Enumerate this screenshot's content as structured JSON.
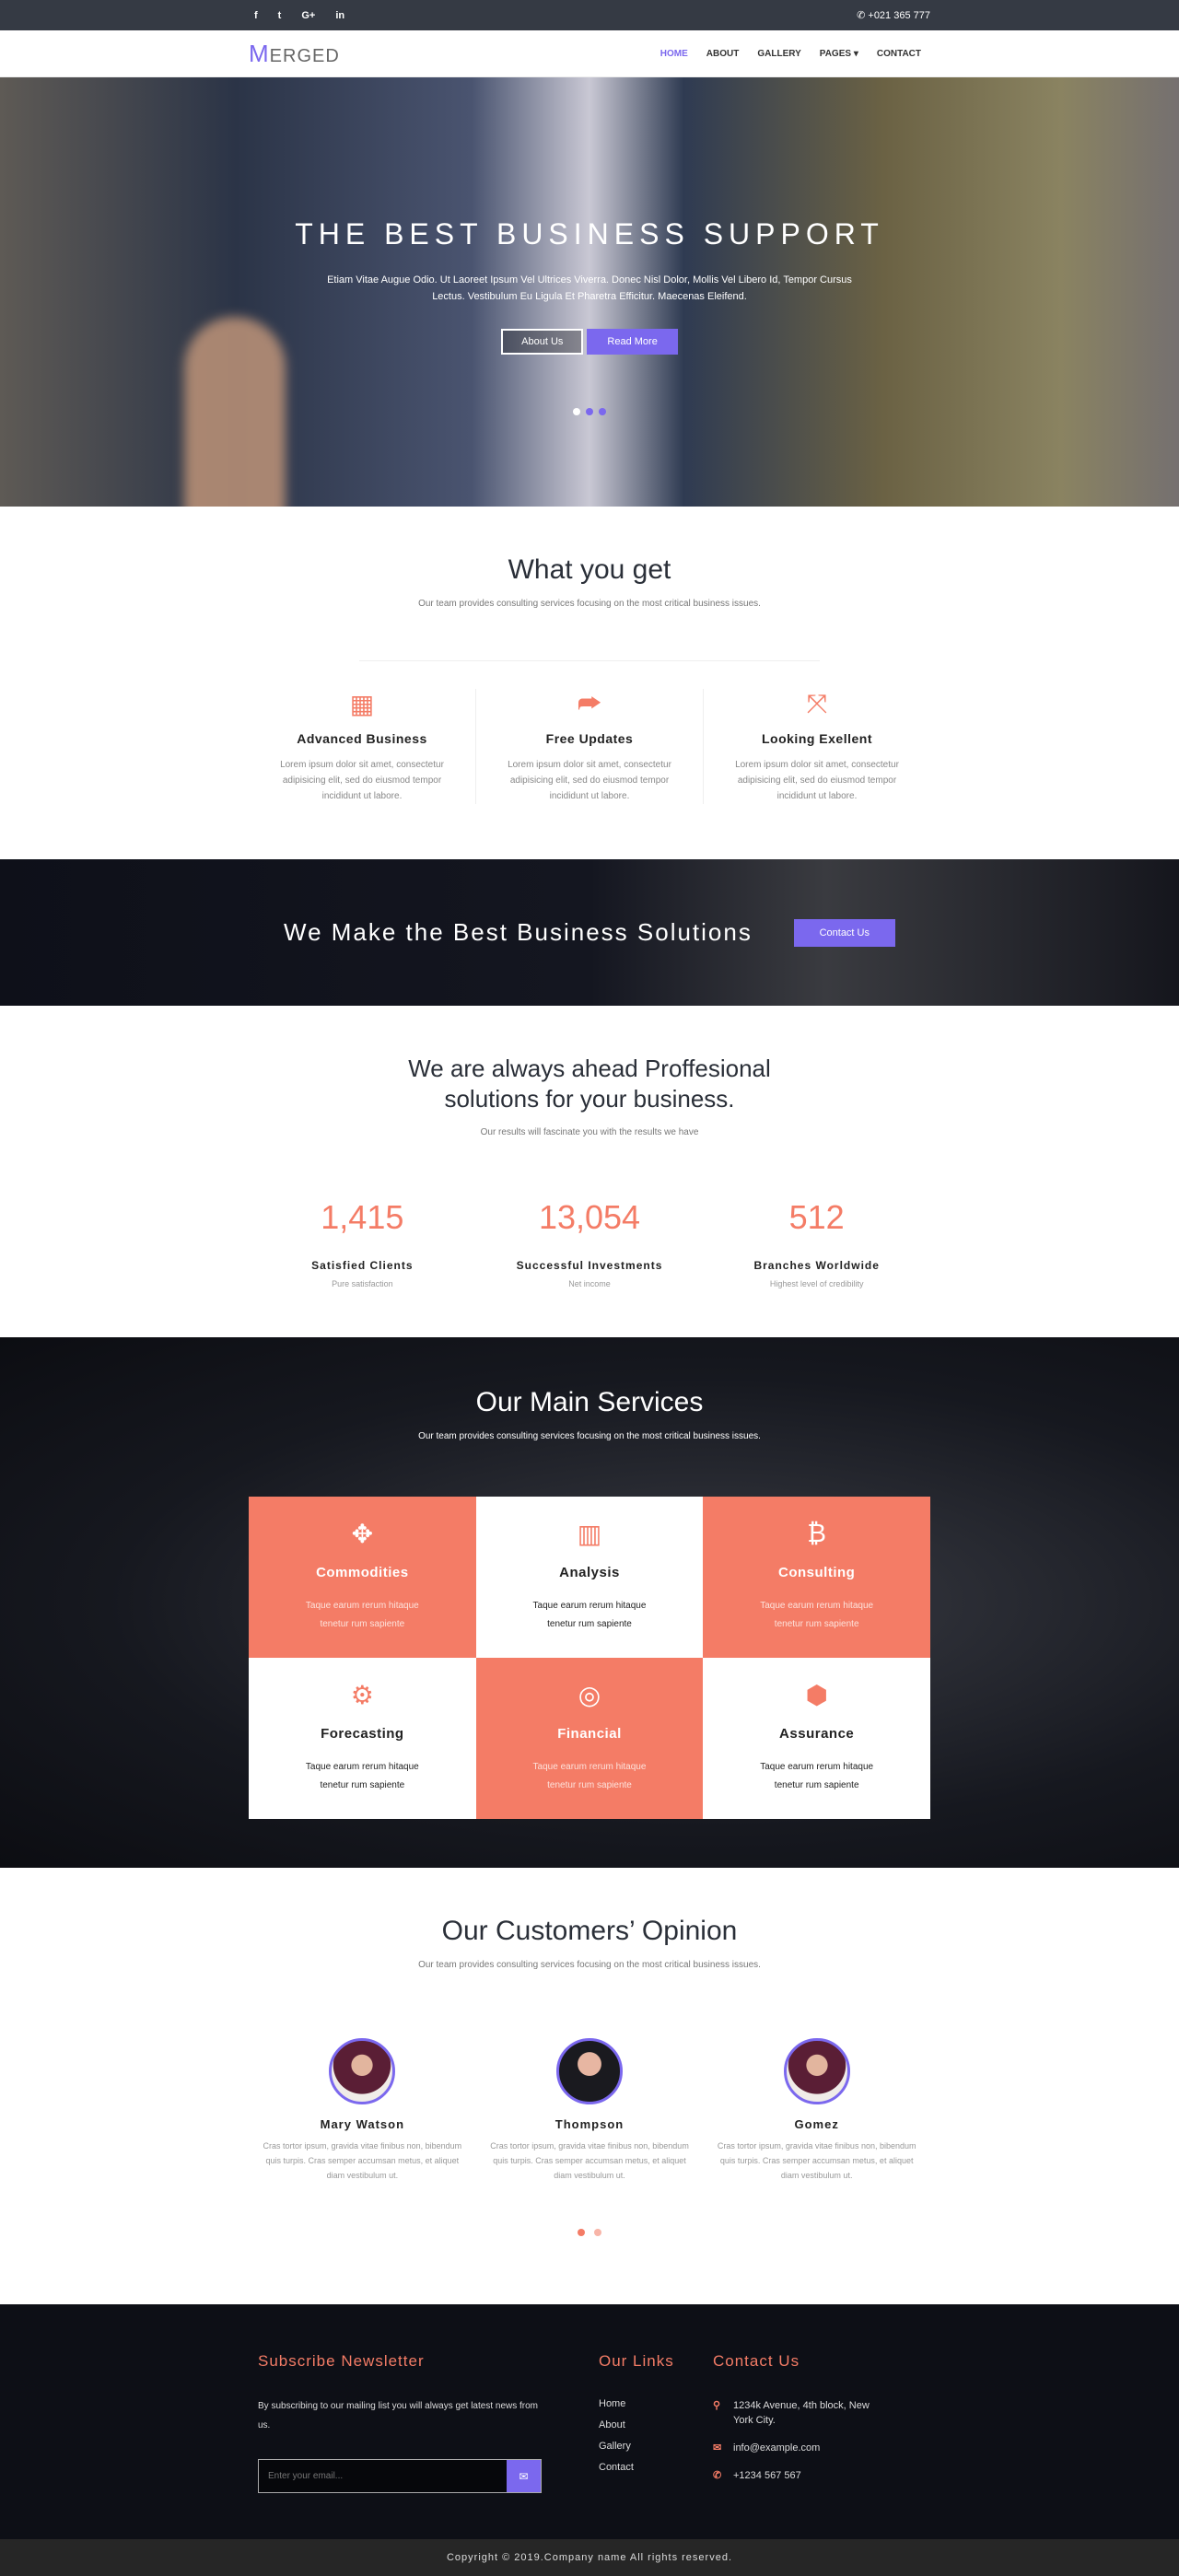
{
  "topbar": {
    "social": [
      "f",
      "t",
      "G+",
      "in"
    ],
    "phone": "+021 365 777"
  },
  "nav": {
    "logo_first": "M",
    "logo_rest": "ERGED",
    "items": [
      "HOME",
      "ABOUT",
      "GALLERY",
      "PAGES ▾",
      "CONTACT"
    ],
    "active": "HOME"
  },
  "hero": {
    "title": "THE BEST BUSINESS SUPPORT",
    "text": "Etiam Vitae Augue Odio. Ut Laoreet Ipsum Vel Ultrices Viverra. Donec Nisl Dolor, Mollis Vel Libero Id, Tempor Cursus Lectus. Vestibulum Eu Ligula Et Pharetra Efficitur. Maecenas Eleifend.",
    "about": "About Us",
    "read": "Read More"
  },
  "what": {
    "title": "What you get",
    "sub": "Our team provides consulting services focusing on the most critical business issues.",
    "items": [
      {
        "icon": "▦",
        "title": "Advanced Business",
        "text": "Lorem ipsum dolor sit amet, consectetur adipisicing elit, sed do eiusmod tempor incididunt ut labore."
      },
      {
        "icon": "⮫",
        "title": "Free Updates",
        "text": "Lorem ipsum dolor sit amet, consectetur adipisicing elit, sed do eiusmod tempor incididunt ut labore."
      },
      {
        "icon": "⤧",
        "title": "Looking Exellent",
        "text": "Lorem ipsum dolor sit amet, consectetur adipisicing elit, sed do eiusmod tempor incididunt ut labore."
      }
    ]
  },
  "band": {
    "title": "We Make the Best Business Solutions",
    "button": "Contact Us"
  },
  "stats": {
    "title1": "We are always ahead Proffesional",
    "title2": "solutions for your business.",
    "sub": "Our results will fascinate you with the results we have",
    "items": [
      {
        "value": "1,415",
        "label": "Satisfied Clients",
        "sub": "Pure satisfaction"
      },
      {
        "value": "13,054",
        "label": "Successful Investments",
        "sub": "Net income"
      },
      {
        "value": "512",
        "label": "Branches Worldwide",
        "sub": "Highest level of credibility"
      }
    ]
  },
  "services": {
    "title": "Our Main Services",
    "sub": "Our team provides consulting services focusing on the most critical business issues.",
    "items": [
      {
        "icon": "✥",
        "title": "Commodities",
        "text": "Taque earum rerum hitaque tenetur rum sapiente"
      },
      {
        "icon": "▥",
        "title": "Analysis",
        "text": "Taque earum rerum hitaque tenetur rum sapiente"
      },
      {
        "icon": "₿",
        "title": "Consulting",
        "text": "Taque earum rerum hitaque tenetur rum sapiente"
      },
      {
        "icon": "⚙",
        "title": "Forecasting",
        "text": "Taque earum rerum hitaque tenetur rum sapiente"
      },
      {
        "icon": "◎",
        "title": "Financial",
        "text": "Taque earum rerum hitaque tenetur rum sapiente"
      },
      {
        "icon": "⬢",
        "title": "Assurance",
        "text": "Taque earum rerum hitaque tenetur rum sapiente"
      }
    ]
  },
  "opinion": {
    "title": "Our Customers’ Opinion",
    "sub": "Our team provides consulting services focusing on the most critical business issues.",
    "items": [
      {
        "name": "Mary Watson",
        "text": "Cras tortor ipsum, gravida vitae finibus non, bibendum quis turpis. Cras semper accumsan metus, et aliquet diam vestibulum ut."
      },
      {
        "name": "Thompson",
        "text": "Cras tortor ipsum, gravida vitae finibus non, bibendum quis turpis. Cras semper accumsan metus, et aliquet diam vestibulum ut."
      },
      {
        "name": "Gomez",
        "text": "Cras tortor ipsum, gravida vitae finibus non, bibendum quis turpis. Cras semper accumsan metus, et aliquet diam vestibulum ut."
      }
    ]
  },
  "footer": {
    "newsletter_title": "Subscribe Newsletter",
    "newsletter_text": "By subscribing to our mailing list you will always get latest news from us.",
    "email_placeholder": "Enter your email...",
    "links_title": "Our Links",
    "links": [
      "Home",
      "About",
      "Gallery",
      "Contact"
    ],
    "contact_title": "Contact Us",
    "address": "1234k Avenue, 4th block, New York City.",
    "email": "info@example.com",
    "phone": "+1234 567 567"
  },
  "copyright": "Copyright © 2019.Company name All rights reserved.",
  "colors": {
    "accent": "#7b68ee",
    "coral": "#f47c66"
  }
}
